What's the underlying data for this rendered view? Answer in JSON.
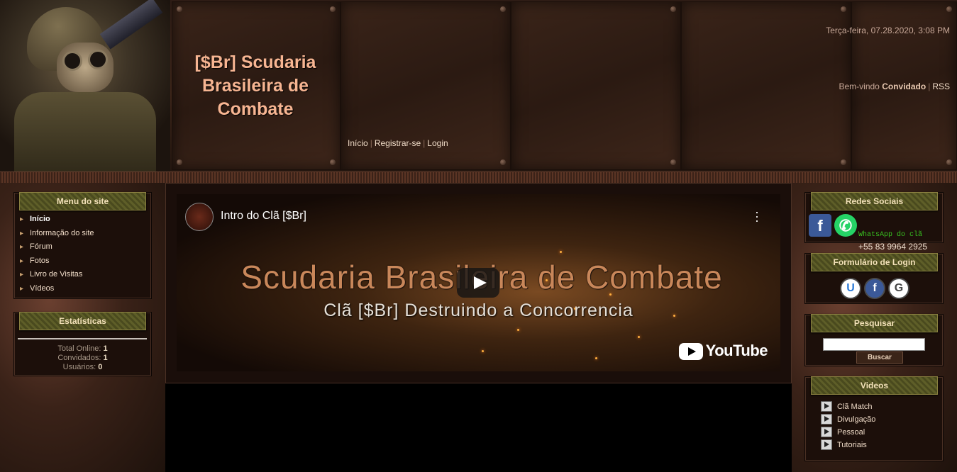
{
  "header": {
    "site_title": "[$Br] Scudaria Brasileira de Combate",
    "date": "Terça-feira, 07.28.2020, 3:08 PM",
    "welcome_prefix": "Bem-vindo",
    "welcome_user": "Convidado",
    "rss": "RSS",
    "nav": [
      "Início",
      "Registrar-se",
      "Login"
    ]
  },
  "left": {
    "menu_title": "Menu do site",
    "menu": [
      "Início",
      "Informação do site",
      "Fórum",
      "Fotos",
      "Livro de Visitas",
      "Vídeos"
    ],
    "stats_title": "Estatísticas",
    "stats": {
      "online_label": "Total Online:",
      "online": "1",
      "guests_label": "Convidados:",
      "guests": "1",
      "users_label": "Usuários:",
      "users": "0"
    }
  },
  "main": {
    "video": {
      "title": "Intro do Clã [$Br]",
      "big_text": "Scudaria Brasileira de Combate",
      "subtitle": "Clã [$Br] Destruindo a Concorrencia",
      "brand": "YouTube"
    }
  },
  "right": {
    "social_title": "Redes Sociais",
    "whatsapp_label": "WhatsApp do clã",
    "phone": "+55 83 9964 2925",
    "login_title": "Formulário de Login",
    "login_icons": [
      "U",
      "f",
      "G"
    ],
    "search_title": "Pesquisar",
    "search_button": "Buscar",
    "videos_title": "Videos",
    "videos": [
      "Clã Match",
      "Divulgação",
      "Pessoal",
      "Tutoriais"
    ]
  },
  "colors": {
    "title": "#f7b592",
    "box_title_bg": "#4a4a1e",
    "facebook": "#3b5998",
    "whatsapp": "#25d366"
  }
}
